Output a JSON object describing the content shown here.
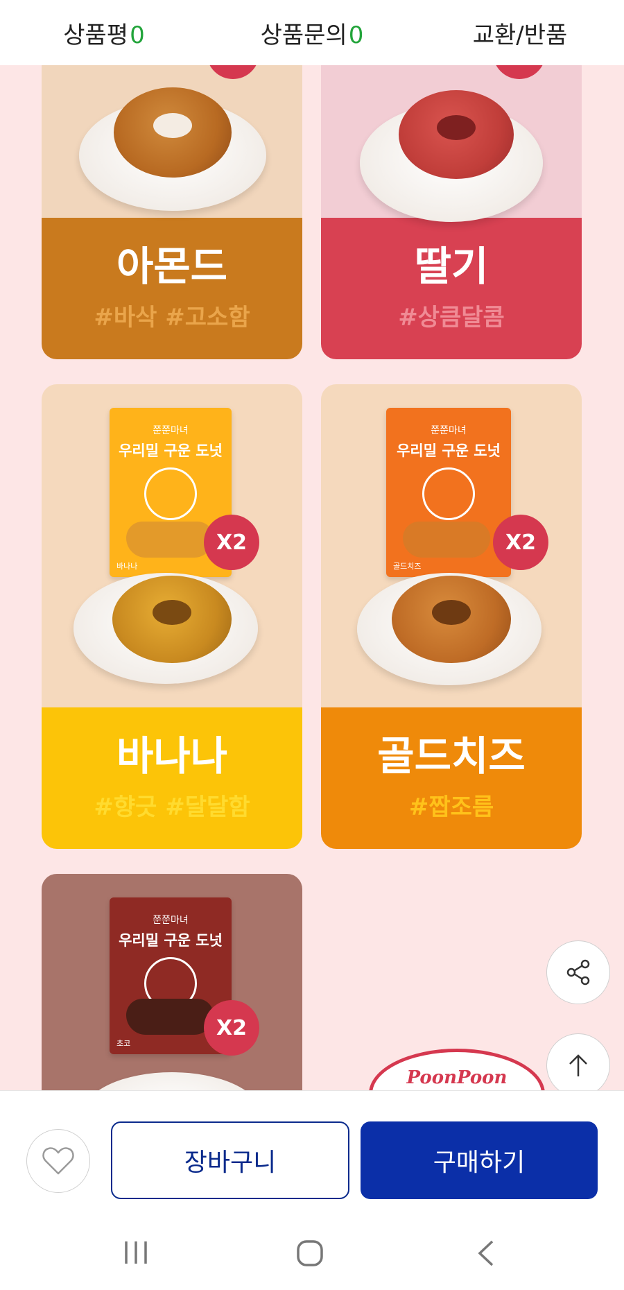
{
  "tabs": [
    {
      "label": "상품평",
      "count": "0"
    },
    {
      "label": "상품문의",
      "count": "0"
    },
    {
      "label": "교환/반품",
      "count": ""
    }
  ],
  "cards": [
    {
      "name": "아몬드",
      "tags": "#바삭 #고소함"
    },
    {
      "name": "딸기",
      "tags": "#상큼달콤"
    },
    {
      "name": "바나나",
      "tags": "#향긋 #달달함",
      "badge": "X2",
      "package": {
        "brand": "쭌쭌마녀",
        "title": "우리밀 구운 도넛",
        "flavor": "바나나"
      }
    },
    {
      "name": "골드치즈",
      "tags": "#짭조름",
      "badge": "X2",
      "package": {
        "brand": "쭌쭌마녀",
        "title": "우리밀 구운 도넛",
        "flavor": "골드치즈"
      }
    },
    {
      "badge": "X2",
      "package": {
        "brand": "쭌쭌마녀",
        "title": "우리밀 구운 도넛",
        "flavor": "초코"
      }
    }
  ],
  "logo_text": "PoonPoon",
  "buttons": {
    "cart": "장바구니",
    "buy": "구매하기"
  },
  "icons": {
    "share": "share-icon",
    "scroll_top": "arrow-up-icon",
    "wish": "heart-icon",
    "nav_recent": "recent-apps-icon",
    "nav_home": "home-icon",
    "nav_back": "back-icon"
  },
  "colors": {
    "accent_blue": "#0b2fa8",
    "count_green": "#22a43a",
    "badge_red": "#d5384f",
    "almond": "#c97a1e",
    "strawberry": "#d84152",
    "banana": "#fcc408",
    "goldcheese": "#ef8a0a"
  }
}
